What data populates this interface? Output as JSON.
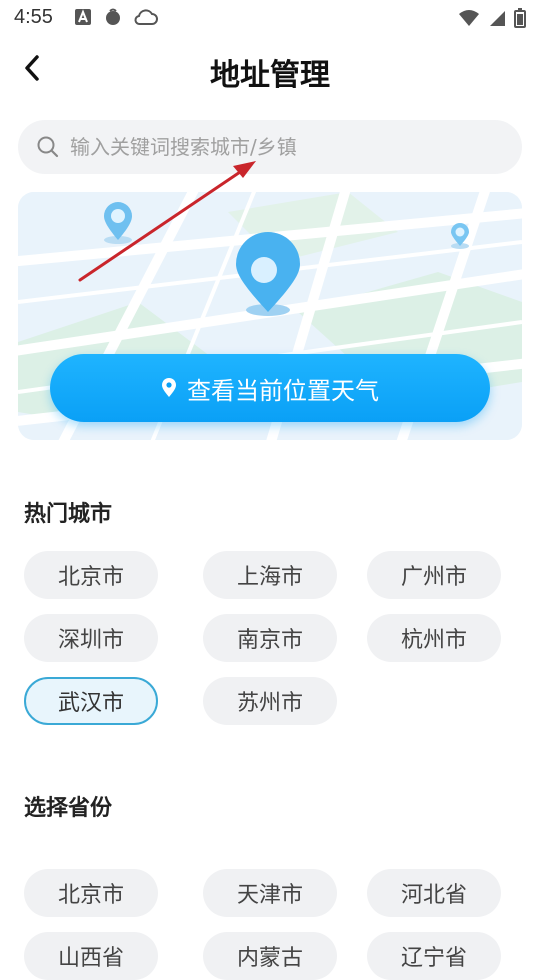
{
  "status_bar": {
    "time": "4:55"
  },
  "header": {
    "title": "地址管理"
  },
  "search": {
    "placeholder": "输入关键词搜索城市/乡镇"
  },
  "map_card": {
    "button_label": "查看当前位置天气"
  },
  "hot_cities": {
    "title": "热门城市",
    "items": [
      "北京市",
      "上海市",
      "广州市",
      "深圳市",
      "南京市",
      "杭州市",
      "武汉市",
      "苏州市"
    ],
    "selected": "武汉市"
  },
  "provinces": {
    "title": "选择省份",
    "items": [
      "北京市",
      "天津市",
      "河北省",
      "山西省",
      "内蒙古",
      "辽宁省"
    ]
  },
  "colors": {
    "accent": "#0aa0f6",
    "selected_border": "#3aa9d6",
    "chip_bg": "#f0f1f3"
  }
}
